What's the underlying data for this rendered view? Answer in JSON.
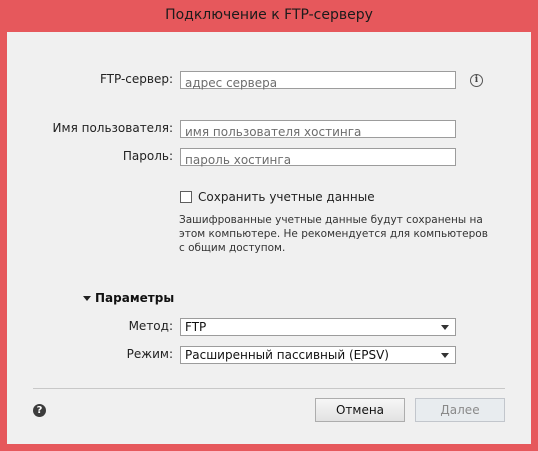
{
  "window": {
    "title": "Подключение к FTP-серверу",
    "accent": "#e6585c"
  },
  "form": {
    "server_label": "FTP-сервер:",
    "server_placeholder": "адрес сервера",
    "info_icon": "i",
    "username_label": "Имя пользователя:",
    "username_placeholder": "имя пользователя хостинга",
    "password_label": "Пароль:",
    "password_placeholder": "пароль хостинга",
    "save_credentials_label": "Сохранить учетные данные",
    "save_credentials_checked": false,
    "note": "Зашифрованные учетные данные будут сохранены на этом компьютере. Не рекомендуется для компьютеров с общим доступом."
  },
  "params": {
    "title": "Параметры",
    "method_label": "Метод:",
    "method_value": "FTP",
    "mode_label": "Режим:",
    "mode_value": "Расширенный пассивный (EPSV)"
  },
  "footer": {
    "help_icon": "?",
    "cancel_label": "Отмена",
    "next_label": "Далее"
  }
}
